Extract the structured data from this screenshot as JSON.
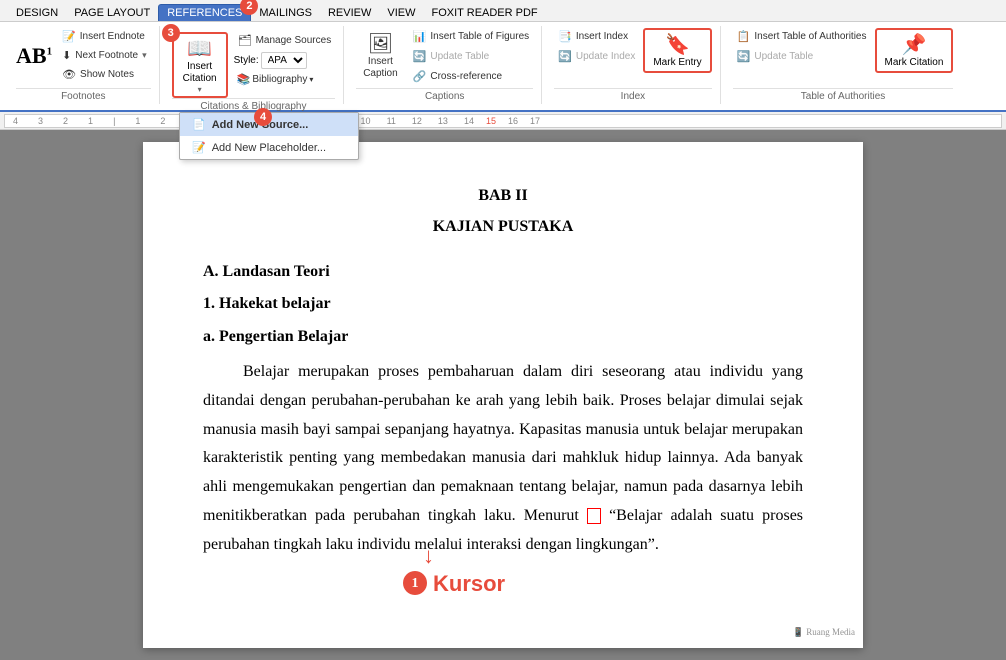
{
  "menubar": {
    "items": [
      {
        "label": "DESIGN",
        "active": false
      },
      {
        "label": "PAGE LAYOUT",
        "active": false
      },
      {
        "label": "REFERENCES",
        "active": true,
        "highlighted": true
      },
      {
        "label": "MAILINGS",
        "active": false
      },
      {
        "label": "REVIEW",
        "active": false
      },
      {
        "label": "VIEW",
        "active": false
      },
      {
        "label": "FOXIT READER PDF",
        "active": false
      }
    ]
  },
  "ribbon": {
    "footnotes_group": {
      "label": "Footnotes",
      "ab_label": "AB",
      "ab_super": "1",
      "insert_footnote": "Insert Footnote",
      "insert_endnote": "Insert Endnote",
      "next_footnote": "Next Footnote",
      "show_notes": "Show Notes",
      "expand_icon": "⊞"
    },
    "citations_group": {
      "label": "Citations & Bibliography",
      "insert_citation": "Insert\nCitation",
      "citation_arrow": "▾",
      "manage_sources": "Manage Sources",
      "style_label": "Style:",
      "style_value": "APA",
      "bibliography": "Bibliography",
      "bibliography_arrow": "▾"
    },
    "captions_group": {
      "label": "Captions",
      "insert_caption": "Insert\nCaption",
      "insert_table_of_figures": "Insert Table of Figures",
      "update_table": "Update Table",
      "cross_reference": "Cross-reference"
    },
    "index_group": {
      "label": "Index",
      "insert_index": "Insert Index",
      "update_index": "Update Index",
      "mark_entry": "Mark\nEntry"
    },
    "authorities_group": {
      "label": "Table of Authorities",
      "insert_table": "Insert Table of Authorities",
      "update_table": "Update Table",
      "mark_citation": "Mark\nCitation"
    }
  },
  "dropdown": {
    "items": [
      {
        "label": "Add New Source...",
        "active": true
      },
      {
        "label": "Add New Placeholder..."
      }
    ]
  },
  "document": {
    "title1": "BAB II",
    "title2": "KAJIAN PUSTAKA",
    "section_a": "A.  Landasan Teori",
    "section_1": "1.   Hakekat belajar",
    "section_a1": "a.   Pengertian Belajar",
    "paragraph1": "Belajar merupakan proses pembaharuan dalam diri seseorang atau individu yang ditandai dengan perubahan-perubahan ke arah yang lebih baik. Proses belajar dimulai sejak manusia masih bayi sampai sepanjang hayatnya. Kapasitas manusia untuk belajar merupakan karakteristik penting yang membedakan manusia dari mahkluk hidup lainnya. Ada banyak ahli mengemukakan pengertian dan pemaknaan tentang belajar, namun pada dasarnya lebih menitikberatkan pada perubahan tingkah laku. Menurut",
    "quote_text": "“Belajar adalah suatu proses perubahan tingkah laku individu melalui interaksi dengan lingkungan”.",
    "kursor_label": "Kursor"
  },
  "badges": {
    "badge1_num": "1",
    "badge2_num": "2",
    "badge3_num": "3",
    "badge4_num": "4"
  },
  "icons": {
    "footnote": "🔗",
    "endnote": "📝",
    "citation": "📖",
    "caption": "🖼",
    "index": "📑",
    "mark": "🔖",
    "table_auth": "📋"
  }
}
